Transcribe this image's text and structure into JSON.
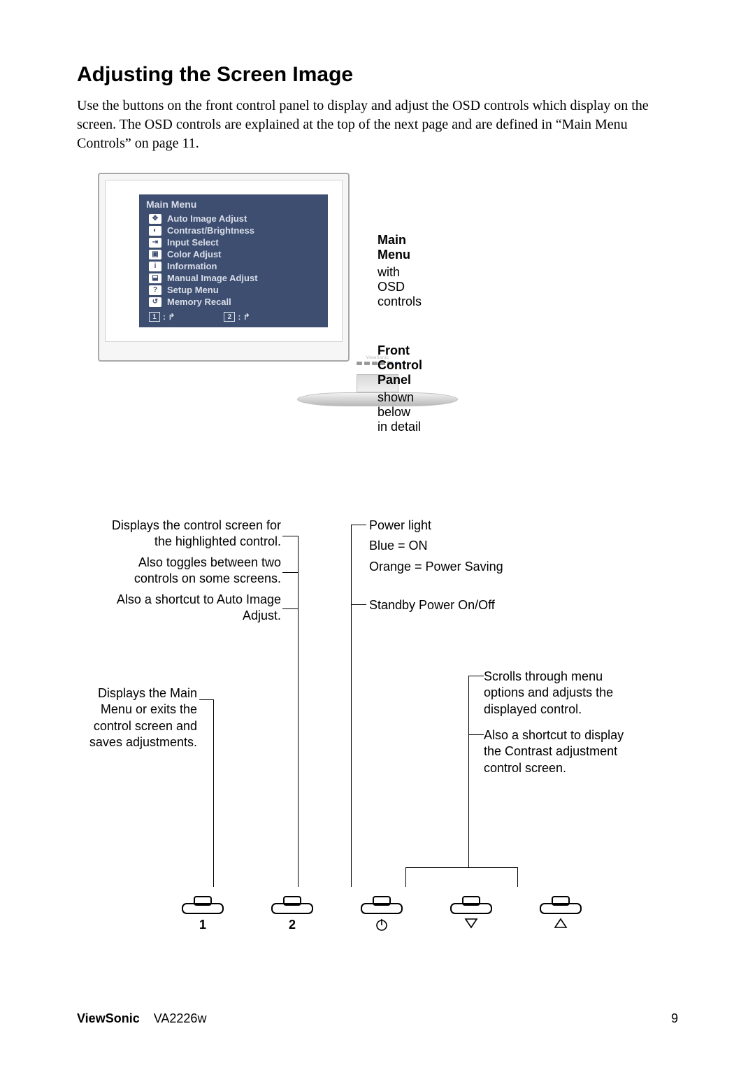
{
  "title": "Adjusting the Screen Image",
  "intro": "Use the buttons on the front control panel to display and adjust the OSD controls which display on the screen. The OSD controls are explained at the top of the next page and are defined in “Main Menu Controls” on page 11.",
  "osd": {
    "title": "Main Menu",
    "items": [
      "Auto Image Adjust",
      "Contrast/Brightness",
      "Input Select",
      "Color Adjust",
      "Information",
      "Manual Image Adjust",
      "Setup Menu",
      "Memory Recall"
    ],
    "footer_left_key": "1",
    "footer_right_key": "2"
  },
  "side": {
    "menu_heading": "Main Menu",
    "menu_sub": "with OSD controls",
    "panel_heading": "Front Control Panel",
    "panel_sub": "shown below in detail"
  },
  "panel_labels": {
    "btn2_a": "Displays the control screen for the highlighted control.",
    "btn2_b": "Also toggles between two controls on some screens.",
    "btn2_c": "Also a shortcut to Auto Image Adjust.",
    "btn1": "Displays the Main Menu or exits the control screen and saves adjustments.",
    "led_a": "Power light",
    "led_b": "Blue = ON",
    "led_c": "Orange = Power Saving",
    "power": "Standby Power On/Off",
    "scroll_a": "Scrolls through menu options and adjusts the displayed control.",
    "scroll_b": "Also a shortcut to display the Contrast adjustment control screen."
  },
  "buttons": {
    "b1": "1",
    "b2": "2"
  },
  "footer": {
    "brand": "ViewSonic",
    "model": "VA2226w",
    "page": "9"
  }
}
